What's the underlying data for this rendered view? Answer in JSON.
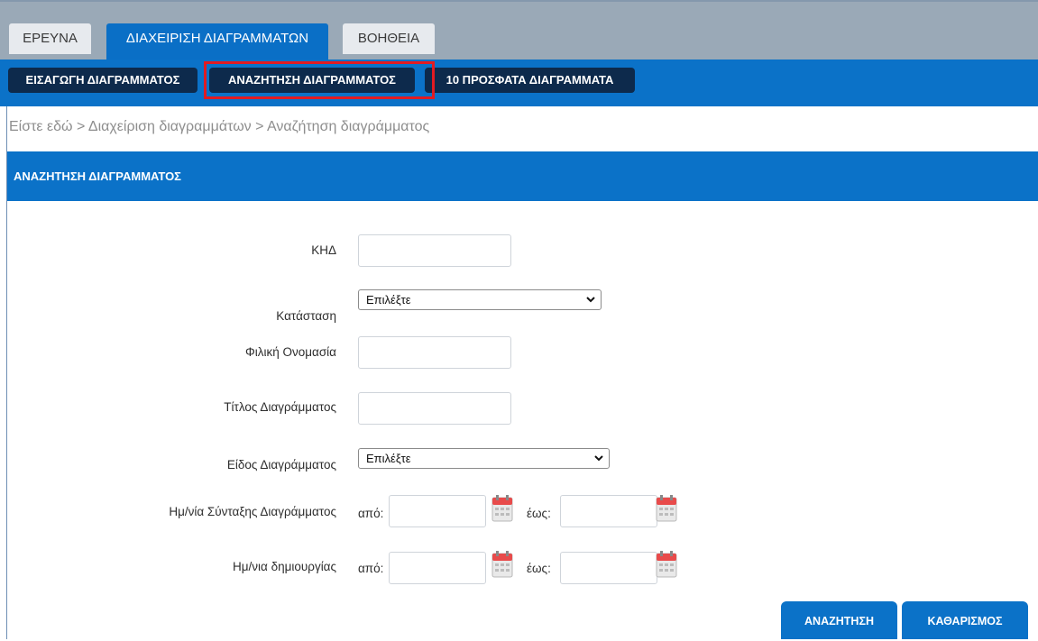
{
  "tabs": [
    {
      "label": "ΕΡΕΥΝΑ"
    },
    {
      "label": "ΔΙΑΧΕΙΡΙΣΗ ΔΙΑΓΡΑΜΜΑΤΩΝ"
    },
    {
      "label": "ΒΟΗΘΕΙΑ"
    }
  ],
  "subnav": [
    {
      "label": "ΕΙΣΑΓΩΓΗ ΔΙΑΓΡΑΜΜΑΤΟΣ"
    },
    {
      "label": "ΑΝΑΖΗΤΗΣΗ ΔΙΑΓΡΑΜΜΑΤΟΣ"
    },
    {
      "label": "10 ΠΡΟΣΦΑΤΑ ΔΙΑΓΡΑΜΜΑΤΑ"
    }
  ],
  "breadcrumb": {
    "prefix": "Είστε εδώ",
    "sep": ">",
    "item1": "Διαχείριση διαγραμμάτων",
    "item2": "Αναζήτηση διαγράμματος"
  },
  "section": {
    "title": "ΑΝΑΖΗΤΗΣΗ ΔΙΑΓΡΑΜΜΑΤΟΣ"
  },
  "form": {
    "khd": {
      "label": "ΚΗΔ",
      "value": ""
    },
    "status": {
      "label": "Κατάσταση",
      "selected": "Επιλέξτε"
    },
    "friendly_name": {
      "label": "Φιλική Ονομασία",
      "value": ""
    },
    "title": {
      "label": "Τίτλος Διαγράμματος",
      "value": ""
    },
    "type": {
      "label": "Είδος Διαγράμματος",
      "selected": "Επιλέξτε"
    },
    "compose_date": {
      "label": "Ημ/νία Σύνταξης Διαγράμματος",
      "from": "από:",
      "to": "έως:"
    },
    "create_date": {
      "label": "Ημ/νια δημιουργίας",
      "from": "από:",
      "to": "έως:"
    }
  },
  "buttons": {
    "search": "ΑΝΑΖΗΤΗΣΗ",
    "clear": "ΚΑΘΑΡΙΣΜΟΣ"
  },
  "colors": {
    "primary": "#0b72c8",
    "dark_button": "#0d2a4c",
    "highlight": "#e21b22"
  }
}
